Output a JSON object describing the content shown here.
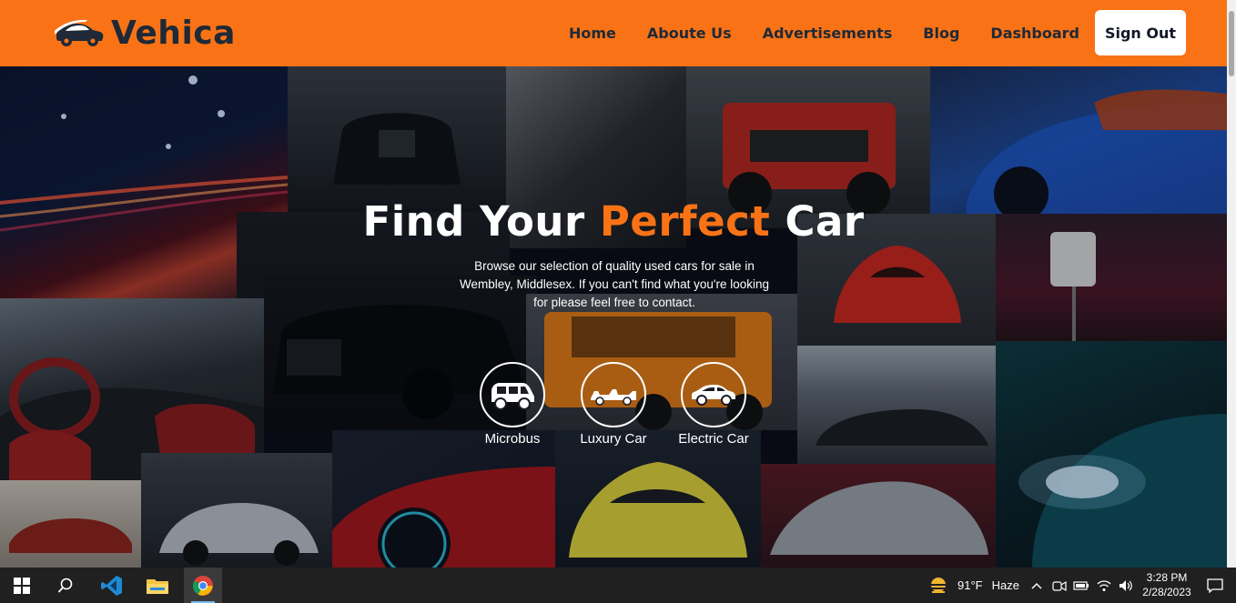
{
  "header": {
    "brand": "Vehica",
    "nav": [
      {
        "label": "Home"
      },
      {
        "label": "Aboute Us"
      },
      {
        "label": "Advertisements"
      },
      {
        "label": "Blog"
      },
      {
        "label": "Dashboard"
      }
    ],
    "sign_out_label": "Sign Out",
    "background_color": "#f97316"
  },
  "hero": {
    "title_before": "Find Your ",
    "title_accent": "Perfect",
    "title_after": " Car",
    "accent_color": "#f97316",
    "description": "Browse our selection of quality used cars for sale in Wembley, Middlesex. If you can't find what you're looking for please feel free to contact.",
    "categories": [
      {
        "label": "Microbus",
        "icon": "microbus-icon"
      },
      {
        "label": "Luxury Car",
        "icon": "race-car-icon"
      },
      {
        "label": "Electric Car",
        "icon": "hatchback-car-icon"
      }
    ]
  },
  "taskbar": {
    "weather": {
      "temperature": "91°F",
      "condition": "Haze"
    },
    "clock": {
      "time": "3:28 PM",
      "date": "2/28/2023"
    },
    "apps": [
      "windows-start-icon",
      "search-icon",
      "vscode-icon",
      "file-explorer-icon",
      "chrome-icon"
    ]
  }
}
